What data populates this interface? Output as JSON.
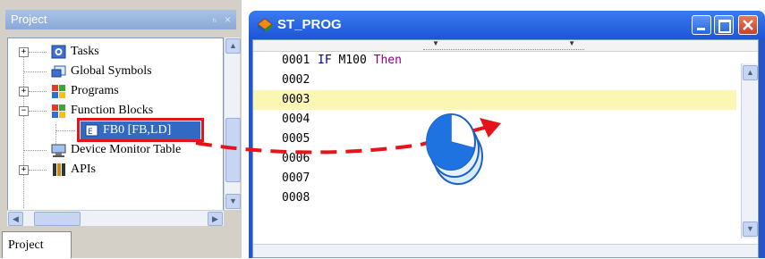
{
  "project_panel": {
    "title": "Project",
    "pin_glyph": "ₕ",
    "close_glyph": "×",
    "tree": [
      {
        "label": "Tasks",
        "icon": "tasks-icon",
        "expander": "+"
      },
      {
        "label": "Global Symbols",
        "icon": "global-symbols-icon",
        "expander": ""
      },
      {
        "label": "Programs",
        "icon": "programs-icon",
        "expander": "+"
      },
      {
        "label": "Function Blocks",
        "icon": "function-blocks-icon",
        "expander": "−"
      },
      {
        "label": "FB0 [FB,LD]",
        "icon": "fb-icon",
        "expander": ""
      },
      {
        "label": "Device Monitor Table",
        "icon": "device-monitor-icon",
        "expander": ""
      },
      {
        "label": "APIs",
        "icon": "apis-icon",
        "expander": "+"
      }
    ],
    "tab_label": "Project"
  },
  "editor_window": {
    "title": "ST_PROG",
    "lines": [
      {
        "num": "0001",
        "kw": "IF",
        "id": "M100",
        "kw2": "Then"
      },
      {
        "num": "0002"
      },
      {
        "num": "0003"
      },
      {
        "num": "0004"
      },
      {
        "num": "0005"
      },
      {
        "num": "0006"
      },
      {
        "num": "0007"
      },
      {
        "num": "0008"
      }
    ]
  },
  "colors": {
    "title_bar": "#1c55d8",
    "highlight_row": "#fbf6b3",
    "drag_arrow": "#e4141b",
    "selection_box": "#e4141b"
  }
}
